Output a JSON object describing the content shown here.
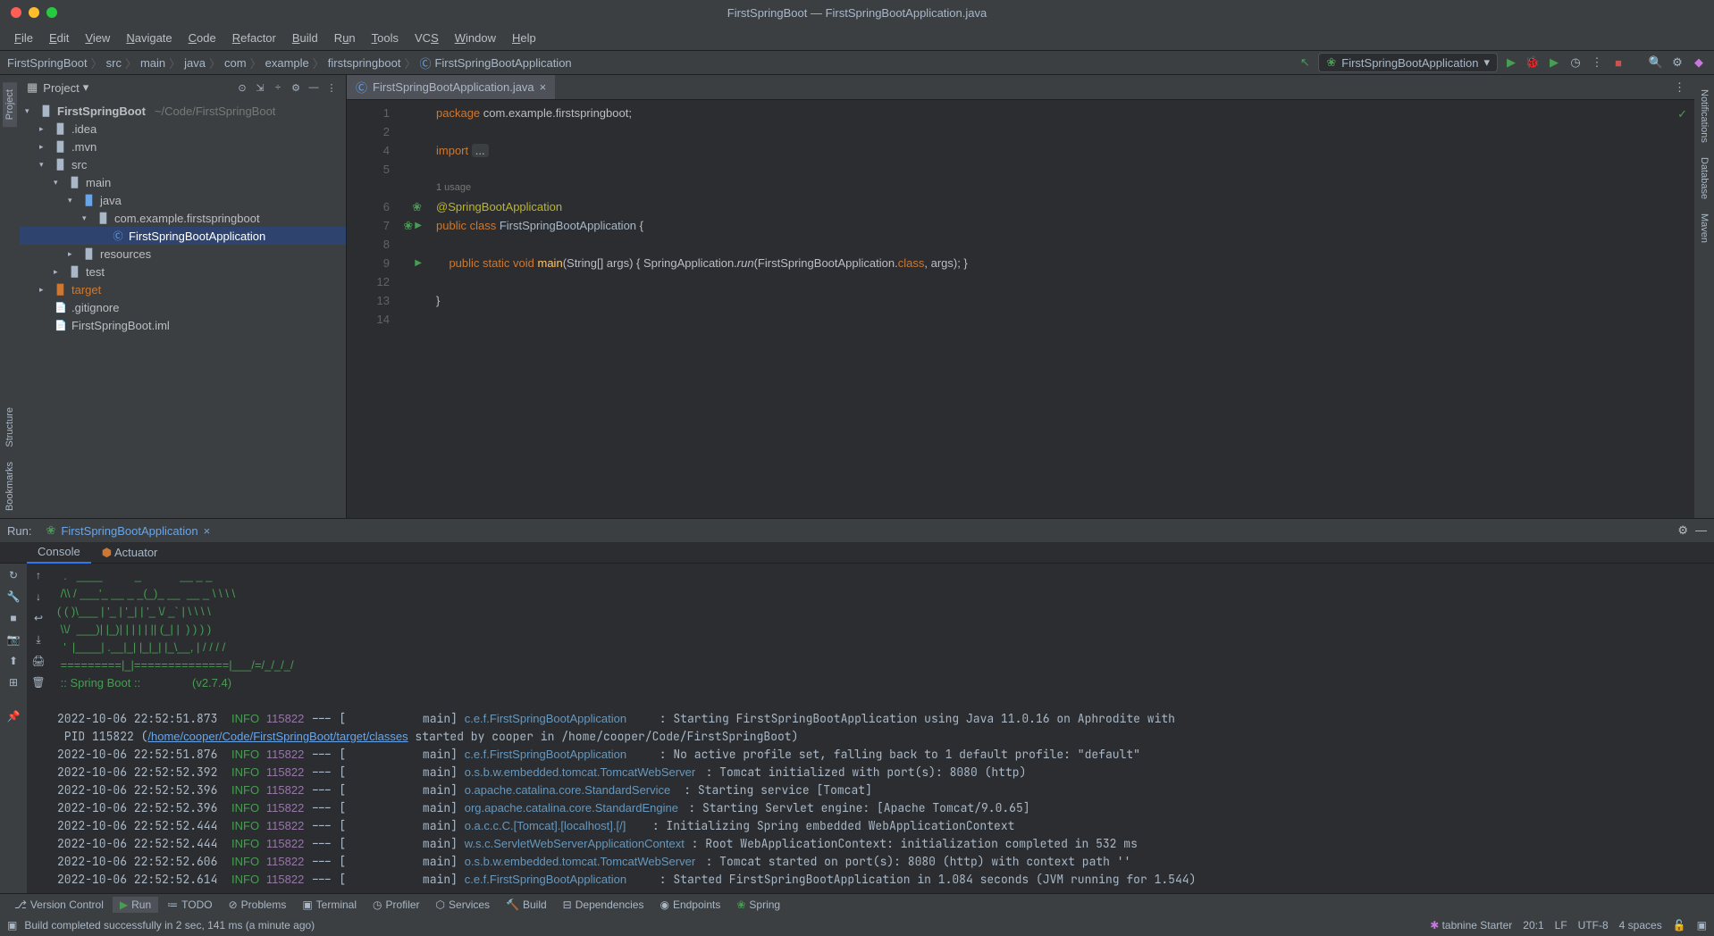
{
  "window_title": "FirstSpringBoot — FirstSpringBootApplication.java",
  "menu": [
    "File",
    "Edit",
    "View",
    "Navigate",
    "Code",
    "Refactor",
    "Build",
    "Run",
    "Tools",
    "VCS",
    "Window",
    "Help"
  ],
  "breadcrumb": [
    "FirstSpringBoot",
    "src",
    "main",
    "java",
    "com",
    "example",
    "firstspringboot",
    "FirstSpringBootApplication"
  ],
  "run_config": "FirstSpringBootApplication",
  "project_header_title": "Project",
  "tree": {
    "root": "FirstSpringBoot",
    "root_path": "~/Code/FirstSpringBoot",
    "idea": ".idea",
    "mvn": ".mvn",
    "src": "src",
    "main": "main",
    "java": "java",
    "pkg": "com.example.firstspringboot",
    "app": "FirstSpringBootApplication",
    "resources": "resources",
    "test": "test",
    "target": "target",
    "gitignore": ".gitignore",
    "iml": "FirstSpringBoot.iml"
  },
  "editor_tab": "FirstSpringBootApplication.java",
  "code": {
    "l1": {
      "kw": "package",
      "rest": " com.example.firstspringboot;"
    },
    "l4": {
      "kw": "import",
      "fold": "..."
    },
    "usage": "1 usage",
    "l6": "@SpringBootApplication",
    "l7": {
      "kw1": "public",
      "kw2": "class",
      "cls": "FirstSpringBootApplication",
      "brace": " {"
    },
    "l9": {
      "kw1": "public",
      "kw2": "static",
      "kw3": "void",
      "m": "main",
      "args": "(String[] args) { ",
      "app": "SpringApplication.",
      "run": "run",
      "rest": "(FirstSpringBootApplication.",
      "cls": "class",
      "end": ", args); }"
    },
    "l13": "}"
  },
  "line_nums": [
    "1",
    "2",
    "4",
    "5",
    "",
    "6",
    "7",
    "8",
    "9",
    "12",
    "13",
    "14"
  ],
  "run_panel": {
    "label": "Run:",
    "tab": "FirstSpringBootApplication",
    "subtabs": {
      "console": "Console",
      "actuator": "Actuator"
    }
  },
  "ascii": "  .   ____          _            __ _ _\n /\\\\ / ___'_ __ _ _(_)_ __  __ _ \\ \\ \\ \\\n( ( )\\___ | '_ | '_| | '_ \\/ _` | \\ \\ \\ \\\n \\\\/  ___)| |_)| | | | | || (_| |  ) ) ) )\n  '  |____| .__|_| |_|_| |_\\__, | / / / /\n =========|_|==============|___/=/_/_/_/",
  "spring_line": " :: Spring Boot ::                (v2.7.4)",
  "logs": [
    {
      "ts": "2022-10-06 22:52:51.873",
      "lvl": "INFO",
      "pid": "115822",
      "thr": "main",
      "log": "c.e.f.FirstSpringBootApplication",
      "msg": ": Starting FirstSpringBootApplication using Java 11.0.16 on Aphrodite with"
    },
    {
      "extra": "PID 115822 (",
      "link": "/home/cooper/Code/FirstSpringBoot/target/classes",
      "extra2": " started by cooper in /home/cooper/Code/FirstSpringBoot)"
    },
    {
      "ts": "2022-10-06 22:52:51.876",
      "lvl": "INFO",
      "pid": "115822",
      "thr": "main",
      "log": "c.e.f.FirstSpringBootApplication",
      "msg": ": No active profile set, falling back to 1 default profile: \"default\""
    },
    {
      "ts": "2022-10-06 22:52:52.392",
      "lvl": "INFO",
      "pid": "115822",
      "thr": "main",
      "log": "o.s.b.w.embedded.tomcat.TomcatWebServer",
      "msg": ": Tomcat initialized with port(s): 8080 (http)"
    },
    {
      "ts": "2022-10-06 22:52:52.396",
      "lvl": "INFO",
      "pid": "115822",
      "thr": "main",
      "log": "o.apache.catalina.core.StandardService",
      "msg": ": Starting service [Tomcat]"
    },
    {
      "ts": "2022-10-06 22:52:52.396",
      "lvl": "INFO",
      "pid": "115822",
      "thr": "main",
      "log": "org.apache.catalina.core.StandardEngine",
      "msg": ": Starting Servlet engine: [Apache Tomcat/9.0.65]"
    },
    {
      "ts": "2022-10-06 22:52:52.444",
      "lvl": "INFO",
      "pid": "115822",
      "thr": "main",
      "log": "o.a.c.c.C.[Tomcat].[localhost].[/]",
      "msg": ": Initializing Spring embedded WebApplicationContext"
    },
    {
      "ts": "2022-10-06 22:52:52.444",
      "lvl": "INFO",
      "pid": "115822",
      "thr": "main",
      "log": "w.s.c.ServletWebServerApplicationContext",
      "msg": ": Root WebApplicationContext: initialization completed in 532 ms"
    },
    {
      "ts": "2022-10-06 22:52:52.606",
      "lvl": "INFO",
      "pid": "115822",
      "thr": "main",
      "log": "o.s.b.w.embedded.tomcat.TomcatWebServer",
      "msg": ": Tomcat started on port(s): 8080 (http) with context path ''"
    },
    {
      "ts": "2022-10-06 22:52:52.614",
      "lvl": "INFO",
      "pid": "115822",
      "thr": "main",
      "log": "c.e.f.FirstSpringBootApplication",
      "msg": ": Started FirstSpringBootApplication in 1.084 seconds (JVM running for 1.544)"
    }
  ],
  "bottom_tools": {
    "vc": "Version Control",
    "run": "Run",
    "todo": "TODO",
    "problems": "Problems",
    "terminal": "Terminal",
    "profiler": "Profiler",
    "services": "Services",
    "build": "Build",
    "deps": "Dependencies",
    "endpoints": "Endpoints",
    "spring": "Spring"
  },
  "status": {
    "build": "Build completed successfully in 2 sec, 141 ms (a minute ago)",
    "tabnine": "tabnine Starter",
    "pos": "20:1",
    "lf": "LF",
    "enc": "UTF-8",
    "indent": "4 spaces"
  },
  "left_tabs": {
    "project": "Project",
    "structure": "Structure",
    "bookmarks": "Bookmarks"
  },
  "right_tabs": {
    "notifications": "Notifications",
    "database": "Database",
    "maven": "Maven"
  }
}
